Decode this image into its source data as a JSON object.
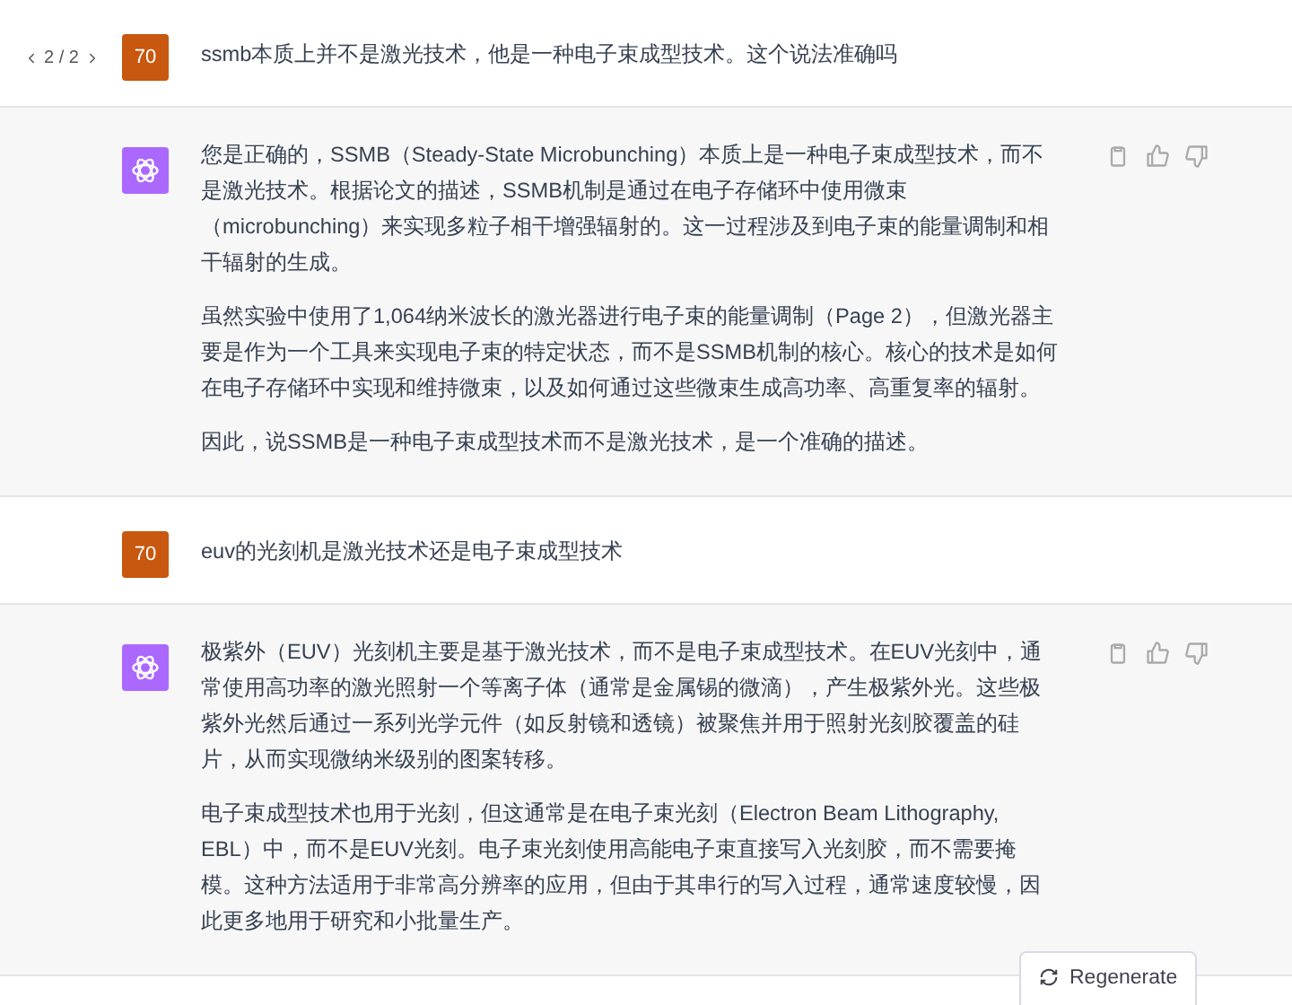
{
  "messages": [
    {
      "kind": "user",
      "avatar": "70",
      "pager": {
        "label": "2 / 2"
      },
      "text": "ssmb本质上并不是激光技术，他是一种电子束成型技术。这个说法准确吗"
    },
    {
      "kind": "assistant",
      "paragraphs": [
        "您是正确的，SSMB（Steady-State Microbunching）本质上是一种电子束成型技术，而不是激光技术。根据论文的描述，SSMB机制是通过在电子存储环中使用微束（microbunching）来实现多粒子相干增强辐射的。这一过程涉及到电子束的能量调制和相干辐射的生成。",
        "虽然实验中使用了1,064纳米波长的激光器进行电子束的能量调制（Page 2），但激光器主要是作为一个工具来实现电子束的特定状态，而不是SSMB机制的核心。核心的技术是如何在电子存储环中实现和维持微束，以及如何通过这些微束生成高功率、高重复率的辐射。",
        "因此，说SSMB是一种电子束成型技术而不是激光技术，是一个准确的描述。"
      ]
    },
    {
      "kind": "user",
      "avatar": "70",
      "text": "euv的光刻机是激光技术还是电子束成型技术"
    },
    {
      "kind": "assistant",
      "paragraphs": [
        "极紫外（EUV）光刻机主要是基于激光技术，而不是电子束成型技术。在EUV光刻中，通常使用高功率的激光照射一个等离子体（通常是金属锡的微滴），产生极紫外光。这些极紫外光然后通过一系列光学元件（如反射镜和透镜）被聚焦并用于照射光刻胶覆盖的硅片，从而实现微纳米级别的图案转移。",
        "电子束成型技术也用于光刻，但这通常是在电子束光刻（Electron Beam Lithography, EBL）中，而不是EUV光刻。电子束光刻使用高能电子束直接写入光刻胶，而不需要掩模。这种方法适用于非常高分辨率的应用，但由于其串行的写入过程，通常速度较慢，因此更多地用于研究和小批量生产。"
      ]
    }
  ],
  "regenerate_button": {
    "label": "Regenerate"
  }
}
